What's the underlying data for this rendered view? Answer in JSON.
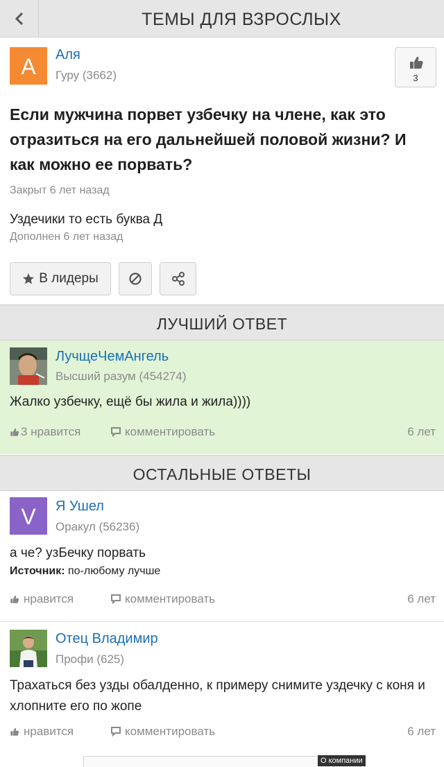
{
  "header": {
    "title": "ТЕМЫ ДЛЯ ВЗРОСЛЫХ",
    "back_icon": "chevron-left-icon"
  },
  "question": {
    "author": {
      "avatar_letter": "A",
      "avatar_color": "#f58a33",
      "name": "Аля",
      "rank": "Гуру (3662)"
    },
    "likes": "3",
    "title": "Если мужчина порвет узбечку на члене, как это отразиться на его дальнейшей половой жизни? И как можно ее порвать?",
    "status": "Закрыт 6 лет назад",
    "addition": "Уздечики то есть буква Д",
    "addition_meta": "Дополнен 6 лет назад",
    "buttons": {
      "leaders_label": "В лидеры"
    }
  },
  "best_answer": {
    "section_title": "ЛУЧШИЙ ОТВЕТ",
    "author": {
      "name": "ЛучщеЧемАнгель",
      "rank": "Высший разум (454274)"
    },
    "text": "Жалко узбечку, ещё бы жила и жила))))",
    "likes_label": "3 нравится",
    "comment_label": "комментировать",
    "age": "6 лет"
  },
  "other_answers": {
    "section_title": "ОСТАЛЬНЫЕ ОТВЕТЫ",
    "items": [
      {
        "author": {
          "avatar_letter": "V",
          "avatar_color": "#8a63c9",
          "name": "Я Ушел",
          "rank": "Оракул (56236)"
        },
        "text": "а че? узБечку порвать",
        "source_label": "Источник:",
        "source_value": "по-любому лучше",
        "likes_label": "нравится",
        "comment_label": "комментировать",
        "age": "6 лет"
      },
      {
        "author": {
          "name": "Отец Владимир",
          "rank": "Профи (625)"
        },
        "text": "Трахаться без узды обалденно, к примеру снимите уздечку с коня и хлопните его по жопе",
        "likes_label": "нравится",
        "comment_label": "комментировать",
        "age": "6 лет"
      }
    ]
  },
  "ad": {
    "label": "О компании"
  },
  "colors": {
    "link": "#1a6fb8",
    "best_bg": "#e2f4d6",
    "header_bg": "#e6e6e6"
  }
}
